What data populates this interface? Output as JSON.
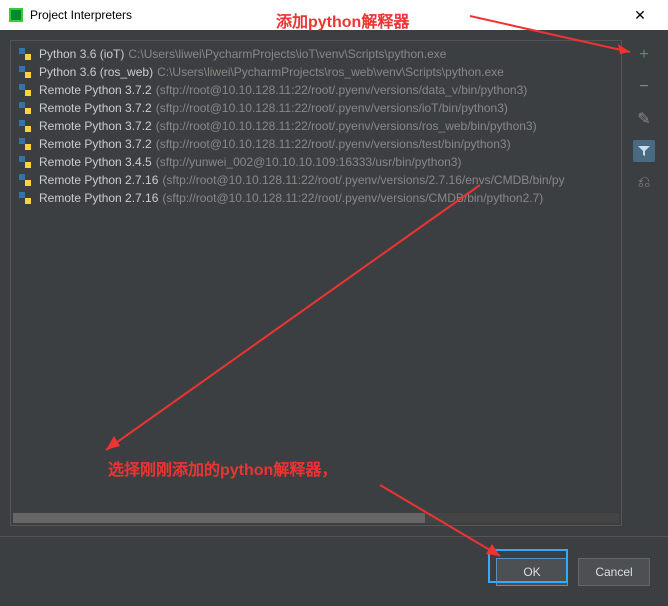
{
  "window": {
    "title": "Project Interpreters",
    "close": "✕"
  },
  "interpreters": [
    {
      "name": "Python 3.6 (ioT)",
      "path": "C:\\Users\\liwei\\PycharmProjects\\ioT\\venv\\Scripts\\python.exe"
    },
    {
      "name": "Python 3.6 (ros_web)",
      "path": "C:\\Users\\liwei\\PycharmProjects\\ros_web\\venv\\Scripts\\python.exe"
    },
    {
      "name": "Remote Python 3.7.2",
      "path": "(sftp://root@10.10.128.11:22/root/.pyenv/versions/data_v/bin/python3)"
    },
    {
      "name": "Remote Python 3.7.2",
      "path": "(sftp://root@10.10.128.11:22/root/.pyenv/versions/ioT/bin/python3)"
    },
    {
      "name": "Remote Python 3.7.2",
      "path": "(sftp://root@10.10.128.11:22/root/.pyenv/versions/ros_web/bin/python3)"
    },
    {
      "name": "Remote Python 3.7.2",
      "path": "(sftp://root@10.10.128.11:22/root/.pyenv/versions/test/bin/python3)"
    },
    {
      "name": "Remote Python 3.4.5",
      "path": "(sftp://yunwei_002@10.10.10.109:16333/usr/bin/python3)"
    },
    {
      "name": "Remote Python 2.7.16",
      "path": "(sftp://root@10.10.128.11:22/root/.pyenv/versions/2.7.16/envs/CMDB/bin/py"
    },
    {
      "name": "Remote Python 2.7.16",
      "path": "(sftp://root@10.10.128.11:22/root/.pyenv/versions/CMDB/bin/python2.7)"
    }
  ],
  "buttons": {
    "ok": "OK",
    "cancel": "Cancel"
  },
  "annotations": {
    "top": "添加python解释器",
    "middle": "选择刚刚添加的python解释器，"
  },
  "icons": {
    "add": "+",
    "remove": "−",
    "edit": "✎",
    "filter": "▼",
    "tree": "⎌"
  }
}
